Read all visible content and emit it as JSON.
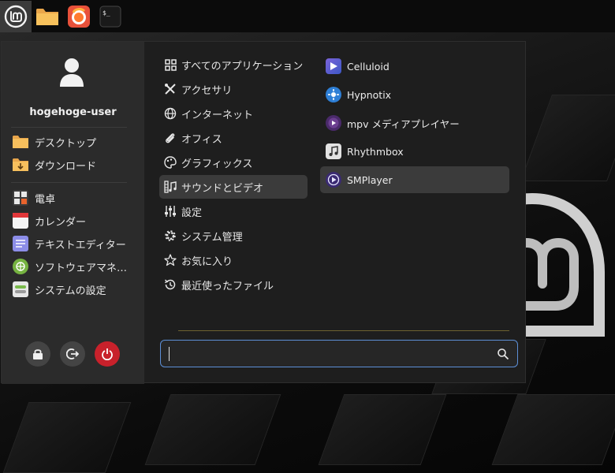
{
  "taskbar": {
    "items": [
      {
        "name": "mint-menu",
        "icon": "linux-mint-logo-icon"
      },
      {
        "name": "files",
        "icon": "folder-icon"
      },
      {
        "name": "firefox",
        "icon": "firefox-icon"
      },
      {
        "name": "terminal",
        "icon": "terminal-icon",
        "label": "$_"
      }
    ]
  },
  "sidebar": {
    "user_name": "hogehoge-user",
    "places": [
      {
        "label": "デスクトップ",
        "icon": "folder-icon"
      },
      {
        "label": "ダウンロード",
        "icon": "download-folder-icon"
      }
    ],
    "favorites": [
      {
        "label": "電卓",
        "icon": "calculator-icon"
      },
      {
        "label": "カレンダー",
        "icon": "calendar-icon"
      },
      {
        "label": "テキストエディター",
        "icon": "text-editor-icon"
      },
      {
        "label": "ソフトウェアマネ…",
        "icon": "software-manager-icon"
      },
      {
        "label": "システムの設定",
        "icon": "system-settings-icon"
      }
    ],
    "actions": [
      {
        "name": "lock",
        "icon": "lock-icon"
      },
      {
        "name": "logout",
        "icon": "logout-icon"
      },
      {
        "name": "shutdown",
        "icon": "power-icon",
        "color": "#c8212b"
      }
    ]
  },
  "categories": [
    {
      "label": "すべてのアプリケーション",
      "icon": "grid-icon"
    },
    {
      "label": "アクセサリ",
      "icon": "tools-icon"
    },
    {
      "label": "インターネット",
      "icon": "globe-icon"
    },
    {
      "label": "オフィス",
      "icon": "paperclip-icon"
    },
    {
      "label": "グラフィックス",
      "icon": "palette-icon"
    },
    {
      "label": "サウンドとビデオ",
      "icon": "film-music-icon",
      "selected": true
    },
    {
      "label": "設定",
      "icon": "sliders-icon"
    },
    {
      "label": "システム管理",
      "icon": "gear-icon"
    },
    {
      "label": "お気に入り",
      "icon": "star-icon"
    },
    {
      "label": "最近使ったファイル",
      "icon": "history-icon"
    }
  ],
  "apps": [
    {
      "label": "Celluloid",
      "icon": "celluloid-icon"
    },
    {
      "label": "Hypnotix",
      "icon": "hypnotix-icon"
    },
    {
      "label": "mpv メディアプレイヤー",
      "icon": "mpv-icon"
    },
    {
      "label": "Rhythmbox",
      "icon": "rhythmbox-icon"
    },
    {
      "label": "SMPlayer",
      "icon": "smplayer-icon",
      "selected": true
    }
  ],
  "search": {
    "value": "",
    "placeholder": ""
  },
  "colors": {
    "accent": "#5d8fd6",
    "selected_bg": "#3b3b3b",
    "sidebar_bg": "#2b2b2b",
    "menu_bg": "#1e1e1e",
    "power": "#c8212b"
  }
}
